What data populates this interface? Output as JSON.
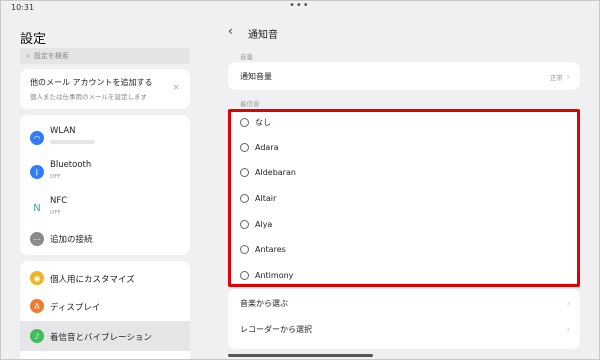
{
  "status": {
    "time": "10:31",
    "dots": "•••"
  },
  "left": {
    "title": "設定",
    "search_placeholder": "設定を検索",
    "mail": {
      "title": "他のメール アカウントを追加する",
      "subtitle": "個人または仕事用のメールを設定します",
      "close": "×"
    },
    "network": [
      {
        "label": "WLAN",
        "sub": "",
        "icon": "wifi-icon",
        "color": "#2f7cf6"
      },
      {
        "label": "Bluetooth",
        "sub": "OFF",
        "icon": "bluetooth-icon",
        "color": "#2f7cf6"
      },
      {
        "label": "NFC",
        "sub": "OFF",
        "icon": "nfc-icon",
        "color": "#2fa7a0"
      },
      {
        "label": "追加の接続",
        "sub": "",
        "icon": "more-connections-icon",
        "color": "#8a8a8f"
      }
    ],
    "personal": [
      {
        "label": "個人用にカスタマイズ",
        "icon": "customize-icon",
        "color": "#f2b420"
      },
      {
        "label": "ディスプレイ",
        "icon": "display-icon",
        "color": "#f07a2e"
      },
      {
        "label": "着信音とバイブレーション",
        "icon": "sound-icon",
        "color": "#3fbf5a"
      }
    ]
  },
  "right": {
    "title": "通知音",
    "volume_section": "音量",
    "volume_label": "通知音量",
    "volume_value": "正常",
    "ringtone_section": "着信音",
    "ringtones": [
      "なし",
      "Adara",
      "Aldebaran",
      "Altair",
      "Alya",
      "Antares",
      "Antimony"
    ],
    "music_label": "音楽から選ぶ",
    "recorder_label": "レコーダーから選択"
  },
  "colors": {
    "highlight": "#e30000"
  }
}
